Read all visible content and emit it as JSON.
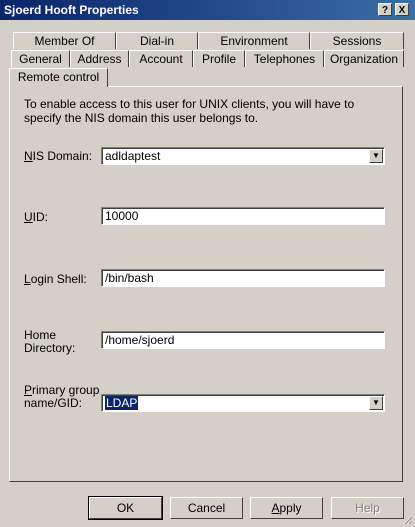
{
  "window": {
    "title": "Sjoerd Hooft Properties",
    "help_button": "?",
    "close_button": "X"
  },
  "tabs": {
    "row1": [
      "Member Of",
      "Dial-in",
      "Environment",
      "Sessions"
    ],
    "row2": [
      "General",
      "Address",
      "Account",
      "Profile",
      "Telephones",
      "Organization"
    ],
    "row3": [
      "Remote control"
    ]
  },
  "panel": {
    "intro": "To enable access to this user for UNIX clients, you will have to specify the NIS domain this user belongs to.",
    "nis_domain": {
      "label_first": "N",
      "label_rest": "IS Domain:",
      "value": "adldaptest"
    },
    "uid": {
      "label_first": "U",
      "label_rest": "ID:",
      "value": "10000"
    },
    "login_shell": {
      "label_first": "L",
      "label_rest": "ogin Shell:",
      "value": "/bin/bash"
    },
    "home_dir": {
      "label_line1": "Home",
      "label_line2": "Directory:",
      "value": "/home/sjoerd"
    },
    "primary_group": {
      "label_first": "P",
      "label_rest_line1": "rimary group",
      "label_line2": "name/GID:",
      "value": "LDAP"
    }
  },
  "buttons": {
    "ok": "OK",
    "cancel": "Cancel",
    "apply_first": "A",
    "apply_rest": "pply",
    "help": "Help"
  }
}
